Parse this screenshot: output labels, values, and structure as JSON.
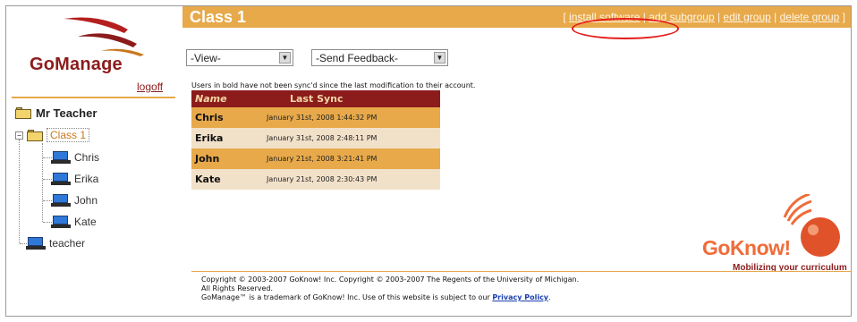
{
  "sidebar": {
    "brand": "GoManage",
    "logoff_label": "logoff",
    "tree": {
      "root_label": "Mr Teacher",
      "class_label": "Class 1",
      "pm_symbol": "−",
      "students": [
        "Chris",
        "Erika",
        "John",
        "Kate"
      ],
      "teacher_label": "teacher"
    }
  },
  "header": {
    "title": "Class 1",
    "links": {
      "install_software": "install software",
      "add_subgroup": "add subgroup",
      "edit_group": "edit group",
      "delete_group": "delete group"
    },
    "bracket_open": "[ ",
    "bracket_close": " ]",
    "separator": " | "
  },
  "controls": {
    "view_select": "-View-",
    "feedback_select": "-Send Feedback-",
    "arrow_glyph": "▼"
  },
  "note": "Users in bold have not been sync'd since the last modification to their account.",
  "table": {
    "headers": {
      "name": "Name",
      "last_sync": "Last Sync"
    },
    "rows": [
      {
        "name": "Chris",
        "last_sync": "January 31st, 2008 1:44:32 PM"
      },
      {
        "name": "Erika",
        "last_sync": "January 31st, 2008 2:48:11 PM"
      },
      {
        "name": "John",
        "last_sync": "January 21st, 2008 3:21:41 PM"
      },
      {
        "name": "Kate",
        "last_sync": "January 21st, 2008 2:30:43 PM"
      }
    ]
  },
  "goknow": {
    "name": "GoKnow!",
    "tagline": "Mobilizing your curriculum"
  },
  "footer": {
    "line1": "Copyright © 2003-2007 GoKnow! Inc. Copyright © 2003-2007 The Regents of the University of Michigan.",
    "line2": "All Rights Reserved.",
    "line3": "GoManage™ is a trademark of GoKnow! Inc. Use of this website is subject to our ",
    "privacy_link": "Privacy Policy",
    "line3_end": "."
  },
  "colors": {
    "brand_red": "#8c1c1c",
    "accent_orange": "#e7a94a",
    "row_light": "#f2e1c9",
    "highlight_circle": "#e41b1b"
  }
}
